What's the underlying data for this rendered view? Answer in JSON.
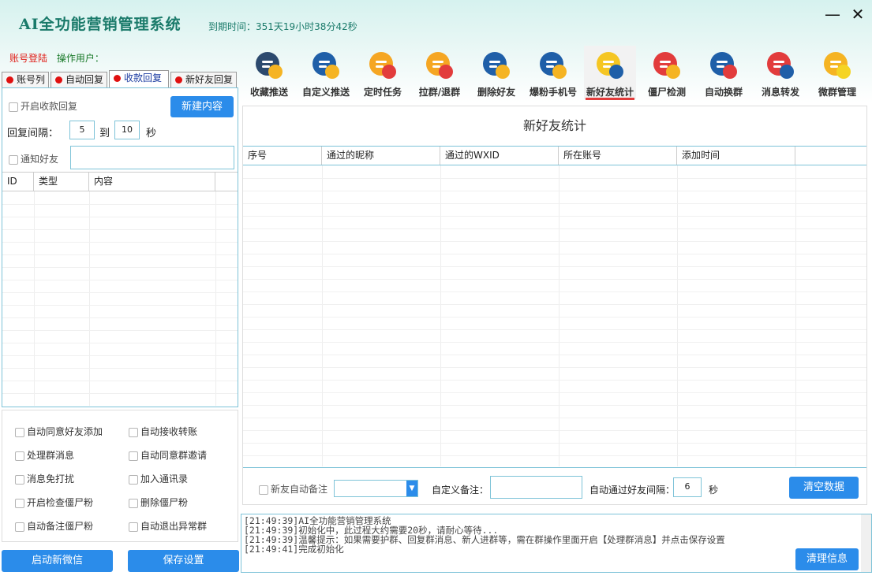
{
  "app": {
    "title": "AI全功能营销管理系统",
    "expire": "到期时间：351天19小时38分42秒"
  },
  "window": {
    "minimize": "—",
    "close": "✕"
  },
  "account": {
    "login": "账号登陆",
    "operator": "操作用户："
  },
  "left_tabs": [
    "账号列",
    "自动回复",
    "收款回复",
    "新好友回复"
  ],
  "left_tabs_active": 2,
  "payment": {
    "enable_label": "开启收款回复",
    "new_button": "新建内容",
    "interval_label": "回复间隔：",
    "interval_from": "5",
    "interval_to_label": "到",
    "interval_to": "10",
    "interval_unit": "秒",
    "notify_label": "通知好友",
    "notify_value": "",
    "table_headers": [
      "ID",
      "类型",
      "内容"
    ]
  },
  "options": [
    [
      "自动同意好友添加",
      "自动接收转账"
    ],
    [
      "处理群消息",
      "自动同意群邀请"
    ],
    [
      "消息免打扰",
      "加入通讯录"
    ],
    [
      "开启检查僵尸粉",
      "删除僵尸粉"
    ],
    [
      "自动备注僵尸粉",
      "自动退出异常群"
    ]
  ],
  "bottom_buttons": {
    "start": "启动新微信",
    "save": "保存设置"
  },
  "toolbar": [
    {
      "label": "收藏推送",
      "icon": "collect-push-icon"
    },
    {
      "label": "自定义推送",
      "icon": "custom-push-icon"
    },
    {
      "label": "定时任务",
      "icon": "timed-task-icon"
    },
    {
      "label": "拉群/退群",
      "icon": "group-join-icon"
    },
    {
      "label": "删除好友",
      "icon": "delete-friend-icon"
    },
    {
      "label": "爆粉手机号",
      "icon": "phone-search-icon"
    },
    {
      "label": "新好友统计",
      "icon": "new-friend-stats-icon"
    },
    {
      "label": "僵尸检测",
      "icon": "zombie-detect-icon"
    },
    {
      "label": "自动换群",
      "icon": "auto-switch-group-icon"
    },
    {
      "label": "消息转发",
      "icon": "message-forward-icon"
    },
    {
      "label": "微群管理",
      "icon": "group-manage-icon"
    }
  ],
  "toolbar_active": 6,
  "stats": {
    "title": "新好友统计",
    "headers": [
      "序号",
      "通过的昵称",
      "通过的WXID",
      "所在账号",
      "添加时间"
    ],
    "auto_remark_label": "新友自动备注",
    "auto_remark_value": "",
    "custom_remark_label": "自定义备注：",
    "custom_remark_value": "",
    "interval_label": "自动通过好友间隔：",
    "interval_value": "6",
    "interval_unit": "秒",
    "clear_button": "清空数据"
  },
  "log": {
    "lines": [
      "[21:49:39]AI全功能营销管理系统",
      "[21:49:39]初始化中，此过程大约需要20秒，请耐心等待...",
      "[21:49:39]温馨提示：如果需要护群、回复群消息、新人进群等，需在群操作里面开启【处理群消息】并点击保存设置",
      "[21:49:41]完成初始化"
    ],
    "clear_button": "清理信息"
  }
}
